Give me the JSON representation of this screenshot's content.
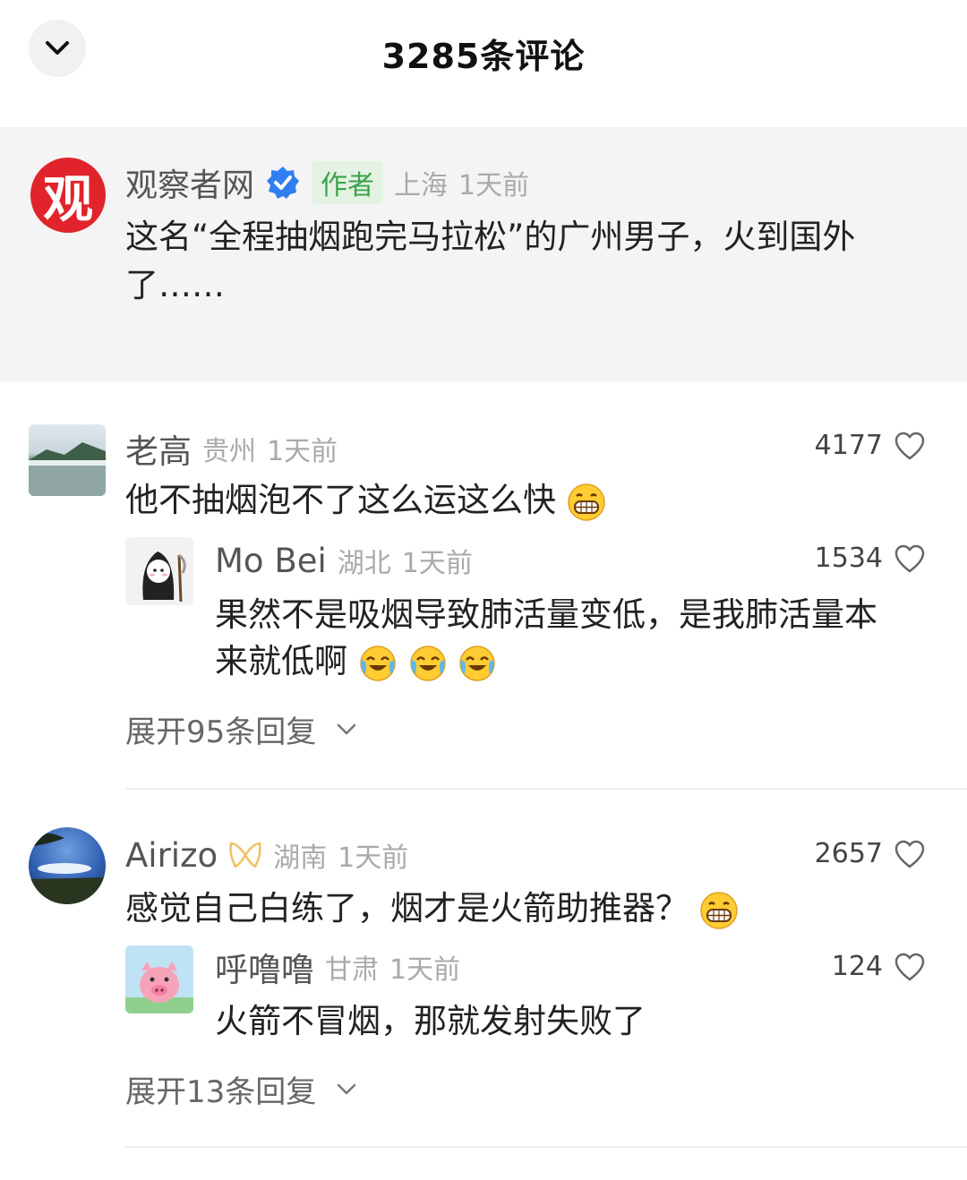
{
  "header": {
    "title": "3285条评论"
  },
  "post": {
    "logo_text": "观",
    "author": "观察者网",
    "author_tag": "作者",
    "location": "上海",
    "time": "1天前",
    "text": "这名“全程抽烟跑完马拉松”的广州男子，火到国外了……"
  },
  "comments": [
    {
      "name": "老高",
      "location": "贵州",
      "time": "1天前",
      "likes": "4177",
      "text": "他不抽烟泡不了这么运这么快",
      "reply": {
        "name": "Mo Bei",
        "location": "湖北",
        "time": "1天前",
        "likes": "1534",
        "text_line1": "果然不是吸烟导致肺活量变低，是我肺活量本",
        "text_line2": "来就低啊"
      },
      "expand": "展开95条回复"
    },
    {
      "name": "Airizo",
      "location": "湖南",
      "time": "1天前",
      "likes": "2657",
      "text": "感觉自己白练了，烟才是火箭助推器？",
      "reply": {
        "name": "呼噜噜",
        "location": "甘肃",
        "time": "1天前",
        "likes": "124",
        "text_line1": "火箭不冒烟，那就发射失败了"
      },
      "expand": "展开13条回复"
    }
  ],
  "colors": {
    "brand_red": "#e1242c",
    "verified_blue": "#2f7ff0",
    "author_tag_green": "#3aa34a",
    "post_bg": "#f4f4f4"
  },
  "icons": [
    "chevron-down-icon",
    "verified-icon",
    "heart-icon",
    "grin-emoji",
    "laugh-cry-emoji",
    "vip-badge-icon"
  ]
}
